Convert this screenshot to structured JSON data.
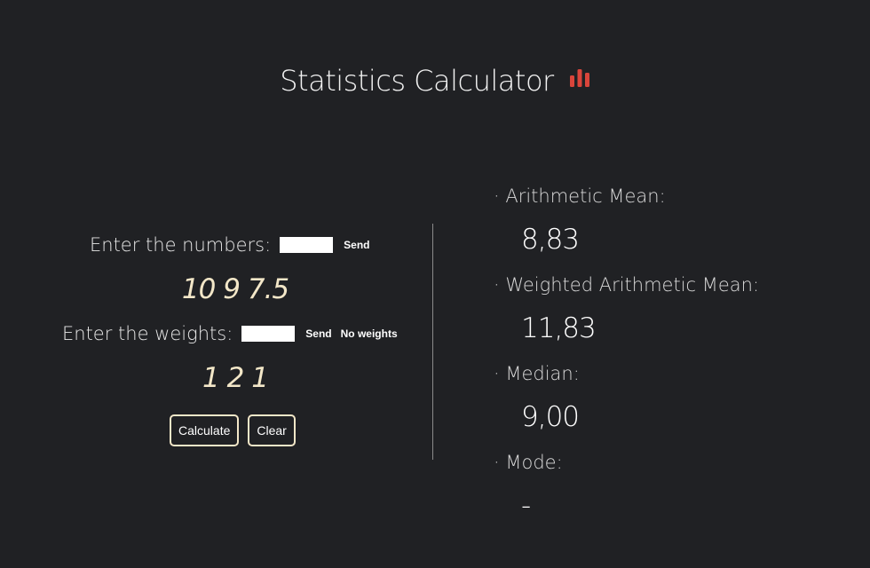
{
  "header": {
    "title": "Statistics Calculator",
    "icon": "bar-chart-icon",
    "icon_color": "#d9453b"
  },
  "numbers": {
    "prompt": "Enter the numbers:",
    "value": "",
    "send_label": "Send",
    "entered": "10 9 7.5"
  },
  "weights": {
    "prompt": "Enter the weights:",
    "value": "",
    "send_label": "Send",
    "no_weights_label": "No weights",
    "entered": "1 2 1"
  },
  "actions": {
    "calculate_label": "Calculate",
    "clear_label": "Clear"
  },
  "results": {
    "arithmetic_mean": {
      "label": "· Arithmetic Mean:",
      "value": "8,83"
    },
    "weighted_mean": {
      "label": "· Weighted Arithmetic Mean:",
      "value": "11,83"
    },
    "median": {
      "label": "· Median:",
      "value": "9,00"
    },
    "mode": {
      "label": "· Mode:",
      "value": "-"
    }
  },
  "colors": {
    "background": "#202124",
    "accent": "#f3e7c8"
  }
}
